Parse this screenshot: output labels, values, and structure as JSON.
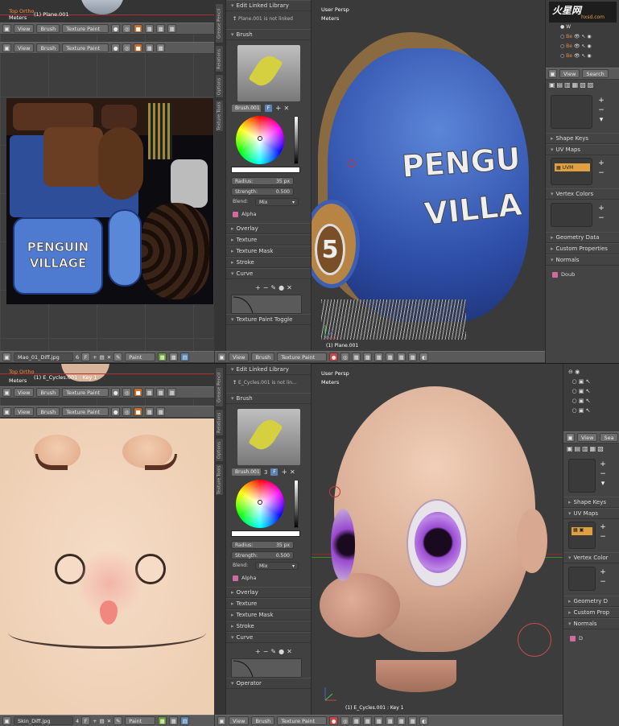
{
  "watermark": {
    "brand": "火星网",
    "url": "hxsd.com"
  },
  "top": {
    "header_left_strip": {
      "title": "Top Ortho",
      "units": "Meters",
      "object": "(1) Plane.001"
    },
    "uv_header1": {
      "view": "View",
      "brush": "Brush",
      "mode": "Texture Paint"
    },
    "uv_header2": {
      "view": "View",
      "brush": "Brush",
      "mode": "Texture Paint"
    },
    "uv_footer": {
      "image_name": "Mao_01_Diff.jpg",
      "users": "6",
      "fake_user": "F",
      "paint": "Paint"
    },
    "tool_tabs": [
      "Grease Pencil",
      "Relations",
      "Options",
      "Texture Tools"
    ],
    "tool_panel": {
      "linked_header": "Edit Linked Library",
      "linked_msg": "Plane.001 is not linked",
      "brush_header": "Brush",
      "brush_name": "Brush.001",
      "brush_users": "F",
      "radius_label": "Radius:",
      "radius_value": "35 px",
      "strength_label": "Strength:",
      "strength_value": "0.500",
      "blend_label": "Blend:",
      "blend_value": "Mix",
      "alpha_label": "Alpha",
      "sections": [
        "Overlay",
        "Texture",
        "Texture Mask",
        "Stroke",
        "Curve"
      ],
      "operator_header": "Texture Paint Toggle"
    },
    "viewport": {
      "title": "User Persp",
      "units": "Meters",
      "object": "(1) Plane.001",
      "hat_text_1": "PENGU",
      "hat_text_2": "VILLA",
      "hat_number": "5"
    },
    "vp_footer": {
      "view": "View",
      "brush": "Brush",
      "mode": "Texture Paint"
    },
    "uv_texture": {
      "line1": "PENGUIN",
      "line2": "VILLAGE"
    },
    "outliner": {
      "items": [
        "W",
        "Be",
        "Be",
        "Be"
      ]
    },
    "props_header": {
      "view": "View",
      "search": "Search"
    },
    "props": {
      "shape_keys": "Shape Keys",
      "uv_maps": "UV Maps",
      "uv_map_name": "UVM",
      "vertex_colors": "Vertex Colors",
      "geometry_data": "Geometry Data",
      "custom_properties": "Custom Properties",
      "normals": "Normals",
      "double_sided": "Doub"
    }
  },
  "bottom": {
    "header_left_strip": {
      "title": "Top Ortho",
      "units": "Meters",
      "object": "(1) E_Cycles.001 : Key 1"
    },
    "uv_header1": {
      "view": "View",
      "brush": "Brush",
      "mode": "Texture Paint"
    },
    "uv_header2": {
      "view": "View",
      "brush": "Brush",
      "mode": "Texture Paint"
    },
    "uv_footer": {
      "image_name": "Skin_Diff.jpg",
      "users": "4",
      "fake_user": "F",
      "paint": "Paint"
    },
    "tool_tabs": [
      "Grease Pencil",
      "Relations",
      "Options",
      "Texture Tools"
    ],
    "tool_panel": {
      "linked_header": "Edit Linked Library",
      "linked_msg": "E_Cycles.001 is not lin...",
      "brush_header": "Brush",
      "brush_name": "Brush.001",
      "brush_users": "3",
      "radius_label": "Radius:",
      "radius_value": "35 px",
      "strength_label": "Strength:",
      "strength_value": "0.500",
      "blend_label": "Blend:",
      "blend_value": "Mix",
      "alpha_label": "Alpha",
      "sections": [
        "Overlay",
        "Texture",
        "Texture Mask",
        "Stroke",
        "Curve"
      ],
      "operator_header": "Operator"
    },
    "viewport": {
      "title": "User Persp",
      "units": "Meters",
      "object": "(1) E_Cycles.001 : Key 1"
    },
    "vp_footer": {
      "view": "View",
      "brush": "Brush",
      "mode": "Texture Paint"
    },
    "props_header": {
      "view": "View",
      "search": "Sea"
    },
    "props": {
      "shape_keys": "Shape Keys",
      "uv_maps": "UV Maps",
      "vertex_colors": "Vertex Color",
      "geometry_data": "Geometry D",
      "custom_properties": "Custom Prop",
      "normals": "Normals",
      "double_sided": "D"
    }
  },
  "colors": {
    "panel": "#414141",
    "header": "#5a5a5a",
    "accent_blue": "#5a84b4",
    "hat_blue": "#3c5fb4",
    "skin": "#f2d6bf"
  }
}
